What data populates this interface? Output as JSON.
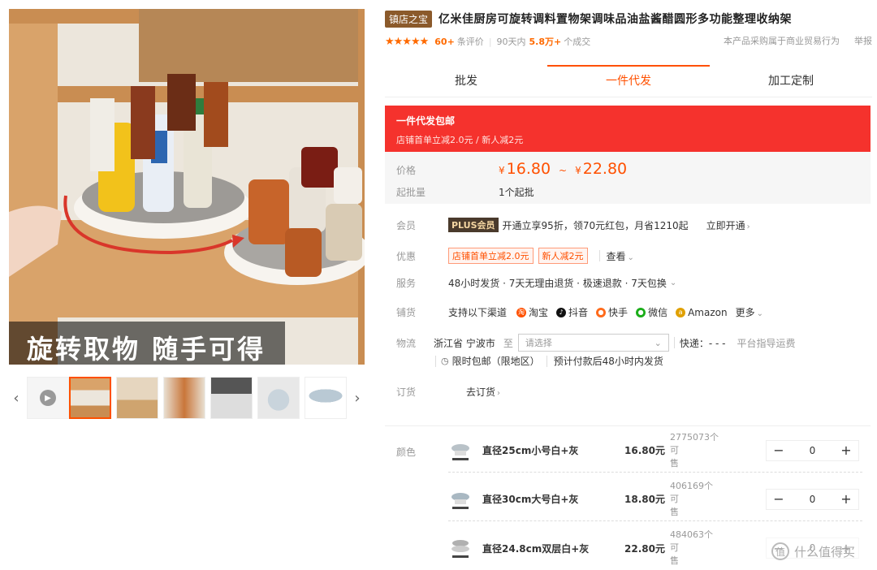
{
  "gallery": {
    "caption": "旋转取物 随手可得",
    "prev_icon": "chevron-left-icon",
    "next_icon": "chevron-right-icon",
    "thumbnails": [
      {
        "name": "video-thumb"
      },
      {
        "name": "photo-thumb-1",
        "active": true
      },
      {
        "name": "photo-thumb-2"
      },
      {
        "name": "photo-thumb-3"
      },
      {
        "name": "photo-thumb-4"
      },
      {
        "name": "photo-thumb-5"
      },
      {
        "name": "photo-thumb-6"
      }
    ]
  },
  "product": {
    "shop_badge": "镇店之宝",
    "title": "亿米佳厨房可旋转调料置物架调味品油盐酱醋圆形多功能整理收纳架",
    "stars": "★★★★★",
    "review_count": "60+",
    "review_label": "条评价",
    "sales_period": "90天内",
    "sales_count": "5.8万+",
    "sales_label": "个成交",
    "trade_note": "本产品采购属于商业贸易行为",
    "report": "举报"
  },
  "tabs": [
    "批发",
    "一件代发",
    "加工定制"
  ],
  "promo": {
    "title": "一件代发包邮",
    "subtitle": "店铺首单立减2.0元 / 新人减2元"
  },
  "price": {
    "label": "价格",
    "currency": "¥",
    "low": "16.80",
    "tilde": "~",
    "high": "22.80",
    "moq_label": "起批量",
    "moq": "1个起批"
  },
  "member": {
    "label": "会员",
    "badge": "PLUS会员",
    "text": "开通立享95折，领70元红包，月省1210起",
    "link": "立即开通"
  },
  "discount": {
    "label": "优惠",
    "coupons": [
      "店铺首单立减2.0元",
      "新人减2元"
    ],
    "view": "查看"
  },
  "service": {
    "label": "服务",
    "text": "48小时发货 · 7天无理由退货 · 极速退款 · 7天包换"
  },
  "channels": {
    "label": "铺货",
    "intro": "支持以下渠道",
    "items": [
      {
        "name": "淘宝",
        "color": "#ff5000",
        "icon": "taobao-icon"
      },
      {
        "name": "抖音",
        "color": "#111111",
        "icon": "douyin-icon"
      },
      {
        "name": "快手",
        "color": "#ff6a1a",
        "icon": "kuaishou-icon"
      },
      {
        "name": "微信",
        "color": "#1aad19",
        "icon": "wechat-icon"
      },
      {
        "name": "Amazon",
        "color": "#e0a000",
        "icon": "amazon-icon"
      }
    ],
    "more": "更多"
  },
  "logistics": {
    "label": "物流",
    "origin": "浙江省 宁波市",
    "to": "至",
    "placeholder": "请选择",
    "express": "快递：- - -",
    "guide": "平台指导运费",
    "limit": "限时包邮（限地区）",
    "eta": "预计付款后48小时内发货"
  },
  "order": {
    "label": "订货",
    "link": "去订货"
  },
  "skus": {
    "label": "颜色",
    "items": [
      {
        "name": "直径25cm小号白+灰",
        "price": "16.80元",
        "stock_num": "2775073个可",
        "stock_unit": "售",
        "qty": "0"
      },
      {
        "name": "直径30cm大号白+灰",
        "price": "18.80元",
        "stock_num": "406169个可",
        "stock_unit": "售",
        "qty": "0"
      },
      {
        "name": "直径24.8cm双层白+灰",
        "price": "22.80元",
        "stock_num": "484063个可",
        "stock_unit": "售",
        "qty": "0"
      }
    ],
    "minus": "−",
    "plus": "+"
  },
  "watermark": {
    "glyph": "值",
    "text": "什么值得买"
  },
  "colors": {
    "accent": "#ff5000",
    "banner": "#f5322d",
    "badge": "#8b5a2b"
  }
}
